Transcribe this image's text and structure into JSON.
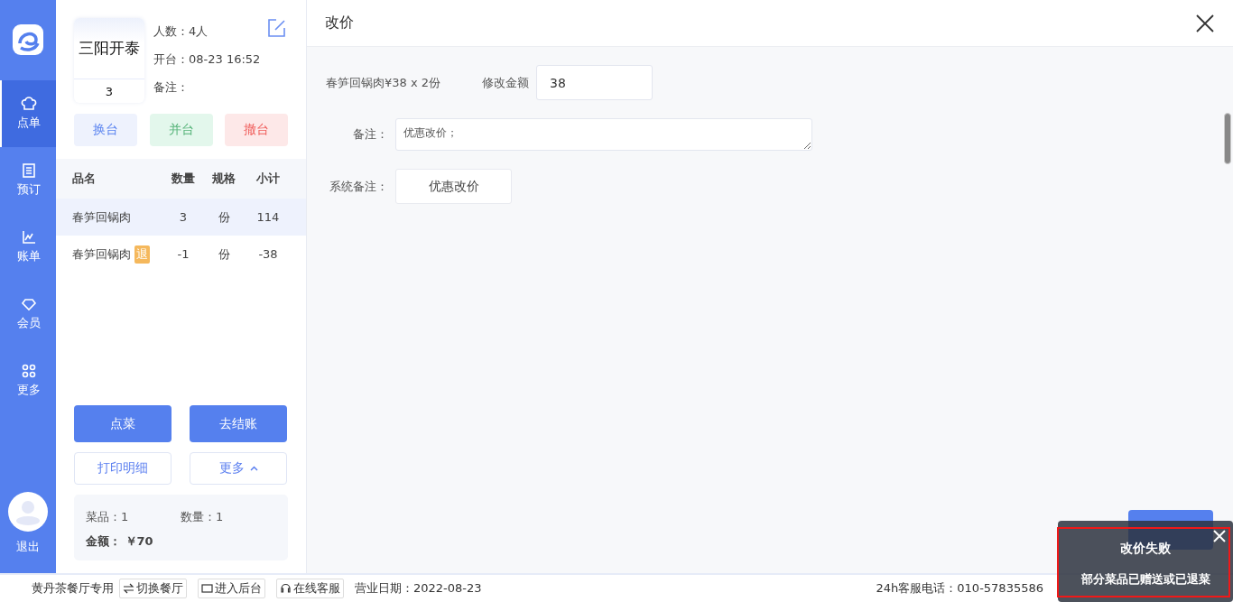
{
  "nav": [
    {
      "label": "点单",
      "kind": "chef",
      "selected": true
    },
    {
      "label": "预订",
      "kind": "book",
      "selected": false
    },
    {
      "label": "账单",
      "kind": "chart",
      "selected": false
    },
    {
      "label": "会员",
      "kind": "gem",
      "selected": false
    },
    {
      "label": "更多",
      "kind": "grid",
      "selected": false
    }
  ],
  "logout": "退出",
  "table_card": {
    "name": "三阳开泰",
    "number": "3",
    "guests": "人数：4人",
    "opened": "开台：08-23 16:52",
    "note": "备注："
  },
  "table_actions": [
    {
      "label": "换台",
      "kind": "blue"
    },
    {
      "label": "并台",
      "kind": "green"
    },
    {
      "label": "撤台",
      "kind": "red"
    }
  ],
  "order": {
    "columns": [
      "品名",
      "数量",
      "规格",
      "小计"
    ],
    "rows": [
      {
        "name": "春笋回锅肉",
        "tag": null,
        "qty": "3",
        "unit": "份",
        "subtotal": "114",
        "selected": true
      },
      {
        "name": "春笋回锅肉",
        "tag": "退",
        "qty": "-1",
        "unit": "份",
        "subtotal": "-38",
        "selected": false
      }
    ]
  },
  "buttons": [
    {
      "label": "点菜",
      "kind": "primary"
    },
    {
      "label": "去结账",
      "kind": "primary"
    },
    {
      "label": "打印明细",
      "kind": "outline"
    },
    {
      "label": "更多",
      "kind": "outline-caret"
    }
  ],
  "summary": {
    "items": "菜品：1",
    "count": "数量：1",
    "amount_label": "金额：",
    "amount": "￥70"
  },
  "dialog": {
    "title": "改价",
    "dish": "春笋回锅肉¥38 x 2份",
    "amount_label": "修改金额",
    "amount_value": "38",
    "note_label": "备注：",
    "note_value": "优惠改价；",
    "system_note_label": "系统备注：",
    "system_notes": [
      "优惠改价"
    ]
  },
  "toast": {
    "title": "改价失败",
    "message": "部分菜品已赠送或已退菜"
  },
  "status_bar": {
    "store": "黄丹茶餐厅专用",
    "links": [
      {
        "label": "切换餐厅",
        "kind": "swap"
      },
      {
        "label": "进入后台",
        "kind": "screen"
      },
      {
        "label": "在线客服",
        "kind": "headset"
      }
    ],
    "business_date": "营业日期：2022-08-23",
    "hotline": "24h客服电话：010-57835586"
  }
}
